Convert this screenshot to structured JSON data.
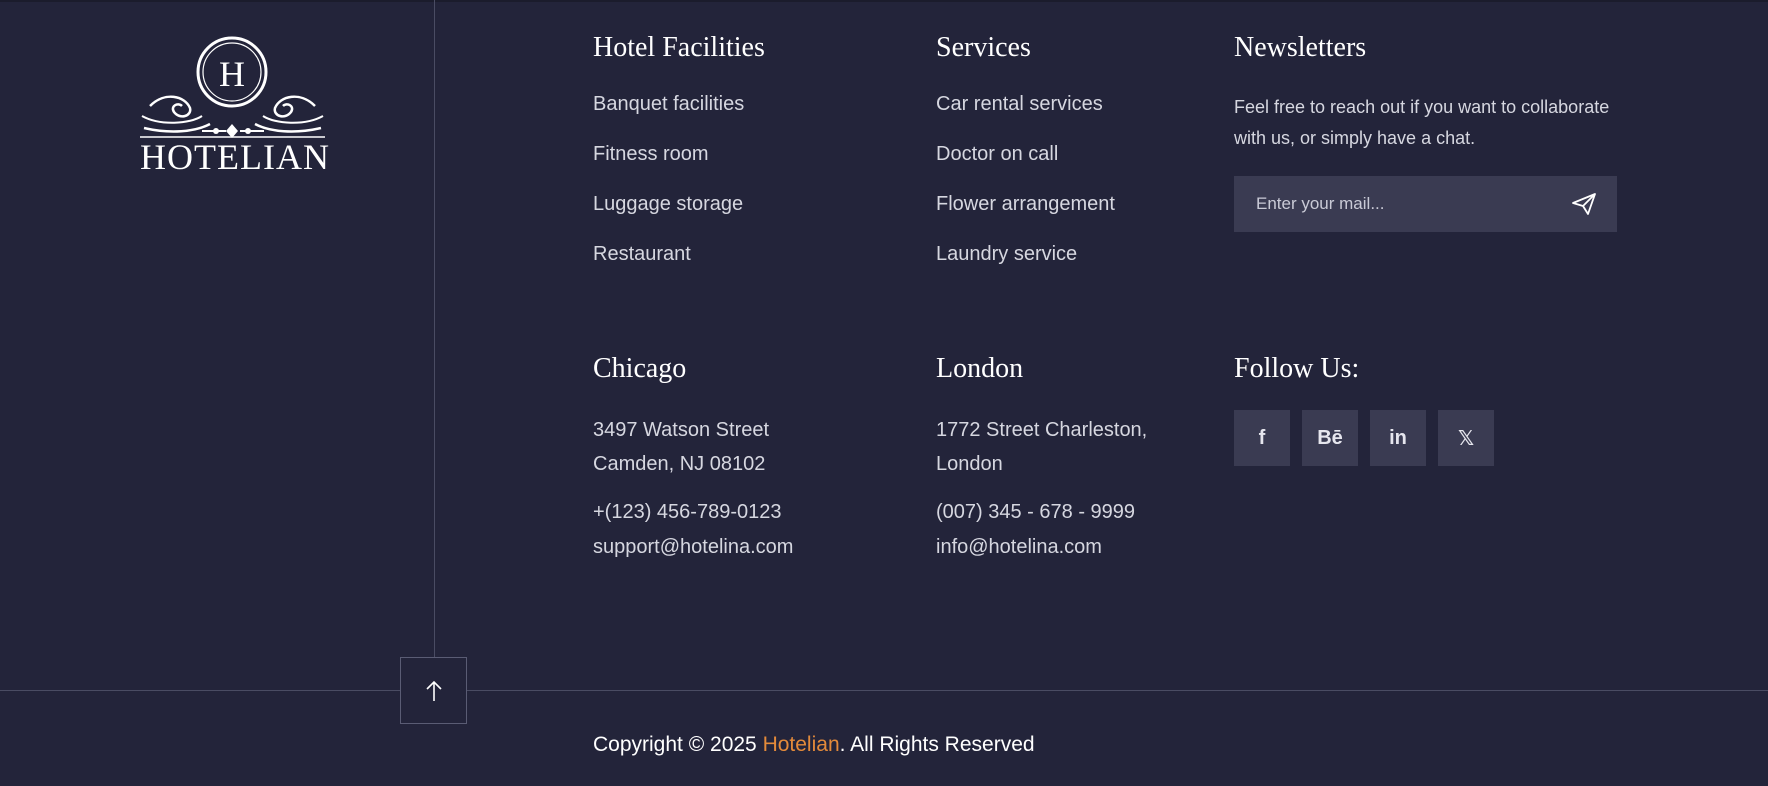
{
  "brand": {
    "name": "HOTELIAN",
    "monogram": "H"
  },
  "facilities": {
    "title": "Hotel Facilities",
    "items": [
      "Banquet facilities",
      "Fitness room",
      "Luggage storage",
      "Restaurant"
    ]
  },
  "services": {
    "title": "Services",
    "items": [
      "Car rental services",
      "Doctor on call",
      "Flower arrangement",
      "Laundry service"
    ]
  },
  "newsletter": {
    "title": "Newsletters",
    "text": "Feel free to reach out if you want to collaborate with us, or simply have a chat.",
    "placeholder": "Enter your mail...",
    "send_icon": "paper-plane-icon"
  },
  "chicago": {
    "title": "Chicago",
    "address_line1": "3497 Watson Street",
    "address_line2": "Camden, NJ 08102",
    "phone": "+(123) 456-789-0123",
    "email": "support@hotelina.com"
  },
  "london": {
    "title": "London",
    "address_line1": "1772 Street Charleston,",
    "address_line2": "London",
    "phone": "(007) 345 - 678 - 9999",
    "email": "info@hotelina.com"
  },
  "follow": {
    "title": "Follow Us:",
    "socials": [
      {
        "name": "facebook-icon",
        "glyph": "f"
      },
      {
        "name": "behance-icon",
        "glyph": "Bē"
      },
      {
        "name": "linkedin-icon",
        "glyph": "in"
      },
      {
        "name": "x-icon",
        "glyph": "𝕏"
      }
    ]
  },
  "footer": {
    "copyright_prefix": "Copyright © 2025 ",
    "copyright_brand": "Hotelian",
    "copyright_suffix": ". All Rights Reserved",
    "scroll_top_icon": "arrow-up-icon"
  },
  "colors": {
    "background": "#23243a",
    "accent": "#e38a3a",
    "input_bg": "#3a3b52"
  }
}
